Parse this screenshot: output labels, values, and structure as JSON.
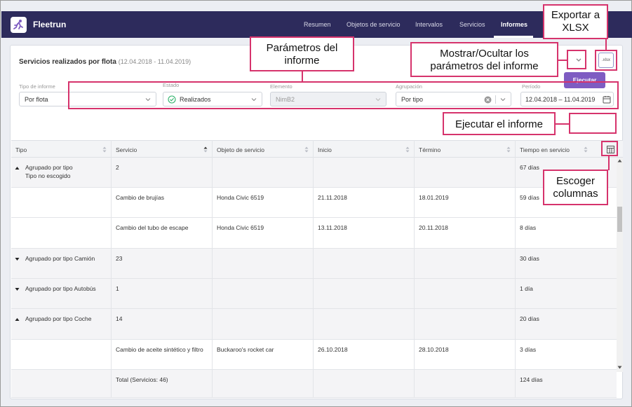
{
  "app": {
    "name": "Fleetrun"
  },
  "nav": [
    {
      "label": "Resumen",
      "active": false
    },
    {
      "label": "Objetos de servicio",
      "active": false
    },
    {
      "label": "Intervalos",
      "active": false
    },
    {
      "label": "Servicios",
      "active": false
    },
    {
      "label": "Informes",
      "active": true
    }
  ],
  "report": {
    "title": "Servicios realizados por flota",
    "period": "(12.04.2018 - 11.04.2019)",
    "xlsx_label": ".xlsx",
    "run_label": "Ejecutar"
  },
  "params": {
    "type": {
      "label": "Tipo de informe",
      "value": "Por flota"
    },
    "state": {
      "label": "Estado",
      "value": "Realizados"
    },
    "element": {
      "label": "Elemento",
      "value": "NimB2"
    },
    "grouping": {
      "label": "Agrupación",
      "value": "Por tipo"
    },
    "period": {
      "label": "Período",
      "value": "12.04.2018 – 11.04.2019"
    }
  },
  "table": {
    "columns": [
      "Tipo",
      "Servicio",
      "Objeto de servicio",
      "Inicio",
      "Término",
      "Tiempo en servicio"
    ],
    "rows": [
      {
        "kind": "group",
        "expanded": true,
        "type": "Agrupado por tipo",
        "type2": "Tipo no escogido",
        "service": "2",
        "object": "",
        "start": "",
        "end": "",
        "time": "67 días"
      },
      {
        "kind": "item",
        "type": "",
        "type2": "",
        "service": "Cambio de brujías",
        "object": "Honda Civic 6519",
        "start": "21.11.2018",
        "end": "18.01.2019",
        "time": "59 días"
      },
      {
        "kind": "item",
        "type": "",
        "type2": "",
        "service": "Cambio del tubo de escape",
        "object": "Honda Civic 6519",
        "start": "13.11.2018",
        "end": "20.11.2018",
        "time": "8 días"
      },
      {
        "kind": "group",
        "expanded": false,
        "type": "Agrupado por tipo Camión",
        "type2": "",
        "service": "23",
        "object": "",
        "start": "",
        "end": "",
        "time": "30 días"
      },
      {
        "kind": "group",
        "expanded": false,
        "type": "Agrupado por tipo Autobús",
        "type2": "",
        "service": "1",
        "object": "",
        "start": "",
        "end": "",
        "time": "1 día"
      },
      {
        "kind": "group",
        "expanded": true,
        "type": "Agrupado por tipo  Coche",
        "type2": "",
        "service": "14",
        "object": "",
        "start": "",
        "end": "",
        "time": "20 días"
      },
      {
        "kind": "item",
        "type": "",
        "type2": "",
        "service": "Cambio de aceite sintético y filtro",
        "object": "Buckaroo's rocket car",
        "start": "26.10.2018",
        "end": "28.10.2018",
        "time": "3 días"
      },
      {
        "kind": "item",
        "type": "",
        "type2": "",
        "service": "Total (Servicios: 46)",
        "object": "",
        "start": "",
        "end": "",
        "time": "124 días"
      }
    ]
  },
  "callouts": {
    "export": "Exportar a XLSX",
    "params": "Parámetros del informe",
    "toggle": "Mostrar/Ocultar los parámetros del informe",
    "run": "Ejecutar el informe",
    "columns": "Escoger columnas"
  },
  "colors": {
    "topbar": "#2d2b5c",
    "accent": "#7e5cc2",
    "callout_border": "#d6336c",
    "success": "#2fb36b"
  }
}
